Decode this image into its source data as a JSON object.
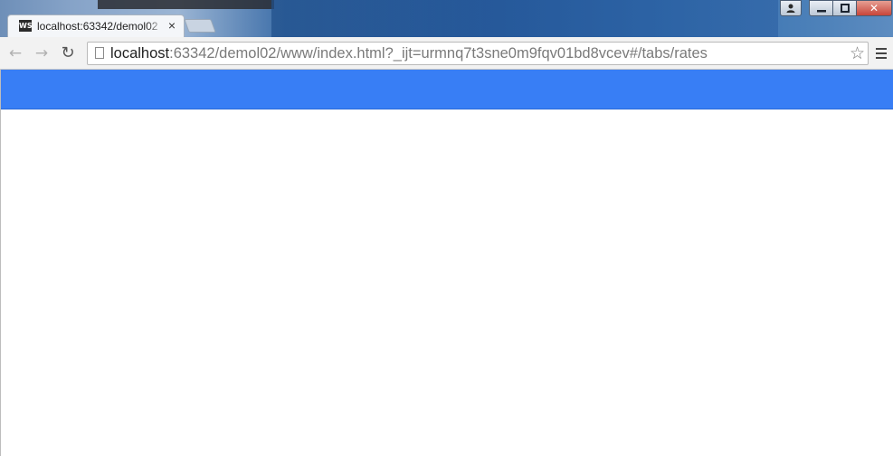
{
  "browser": {
    "tab": {
      "title": "localhost:63342/demol02",
      "favicon_text": "WS",
      "close_glyph": "×"
    },
    "window_controls": {
      "profile_icon": "person-icon",
      "minimize_glyph": "▁",
      "maximize_glyph": "▢",
      "close_glyph": "✕"
    },
    "nav": {
      "back_glyph": "←",
      "forward_glyph": "→",
      "reload_glyph": "↻"
    },
    "address_bar": {
      "host": "localhost",
      "rest": ":63342/demol02/www/index.html?_ijt=urmnq7t3sne0m9fqv01bd8vcev#/tabs/rates"
    },
    "bookmark_glyph": "☆"
  },
  "app": {
    "header_color": "#387ef5"
  }
}
